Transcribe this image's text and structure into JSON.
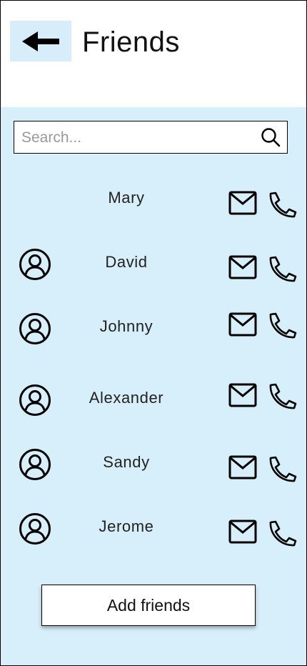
{
  "header": {
    "title": "Friends",
    "back_icon": "arrow-left-icon"
  },
  "search": {
    "placeholder": "Search...",
    "value": "",
    "icon": "search-icon"
  },
  "friends": [
    {
      "name": "Mary",
      "has_avatar": false
    },
    {
      "name": "David",
      "has_avatar": true
    },
    {
      "name": "Johnny",
      "has_avatar": true
    },
    {
      "name": "Alexander",
      "has_avatar": true
    },
    {
      "name": "Sandy",
      "has_avatar": true
    },
    {
      "name": "Jerome",
      "has_avatar": true
    }
  ],
  "actions": {
    "add_friends_label": "Add friends"
  },
  "colors": {
    "panel_background": "#d7eefb",
    "back_button_background": "#d7edfa",
    "border": "#000000"
  }
}
